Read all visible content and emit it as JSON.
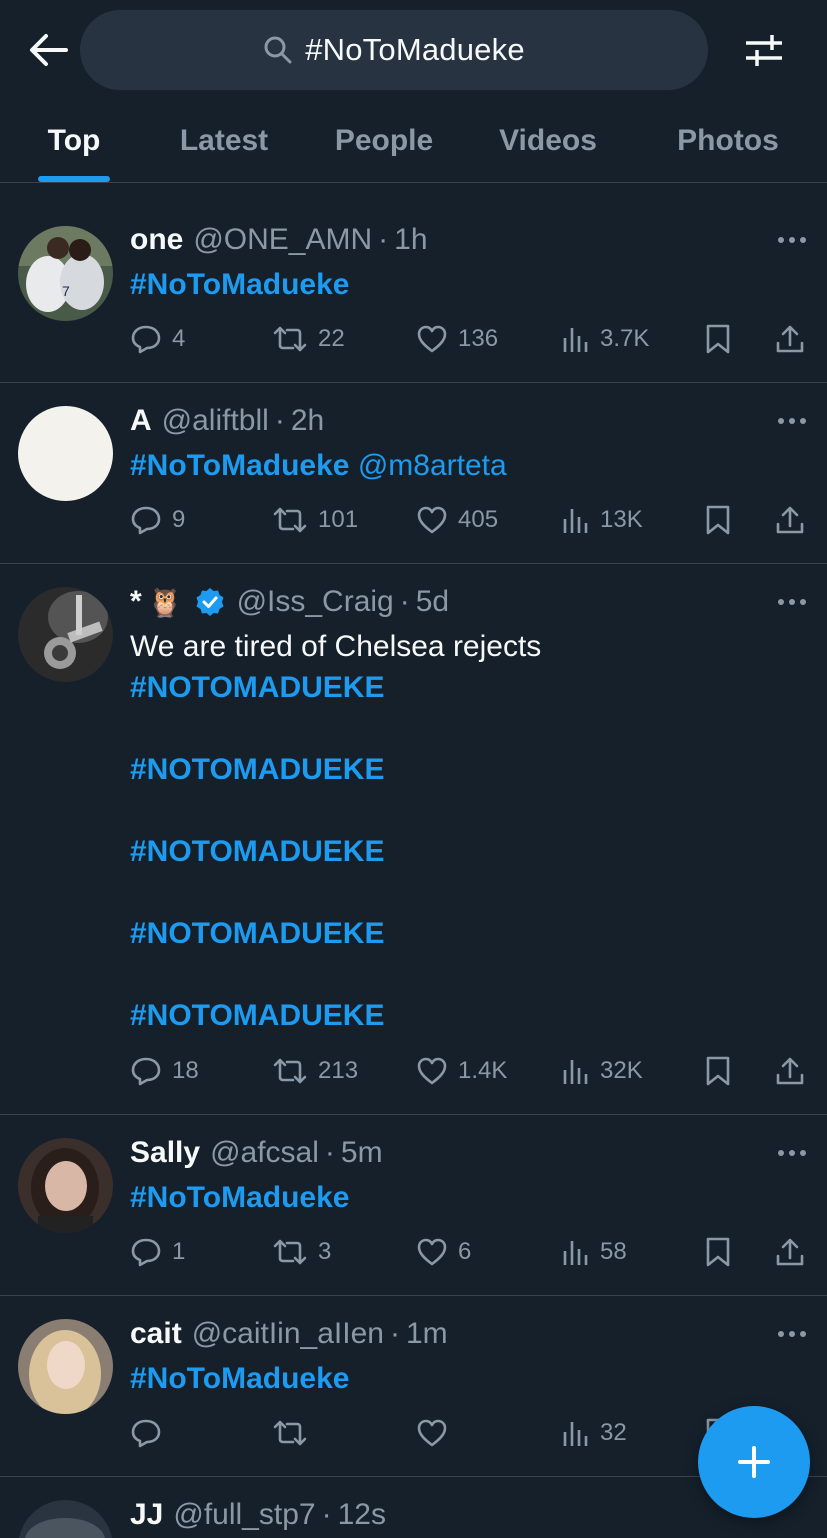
{
  "header": {
    "back_icon": "arrow-left-icon",
    "search_icon": "search-icon",
    "search_query": "#NoToMadueke",
    "filter_icon": "sliders-icon"
  },
  "tabs": [
    {
      "label": "Top",
      "active": true
    },
    {
      "label": "Latest",
      "active": false
    },
    {
      "label": "People",
      "active": false
    },
    {
      "label": "Videos",
      "active": false
    },
    {
      "label": "Photos",
      "active": false
    }
  ],
  "colors": {
    "background": "#15202b",
    "accent": "#1d9bf0",
    "muted": "#8b98a5",
    "divider": "#38444d",
    "verified": "#1d9bf0"
  },
  "tweets": [
    {
      "name": "one",
      "handle": "@ONE_AMN",
      "time": "1h",
      "body": {
        "tag": "#NoToMadueke"
      },
      "replies": "4",
      "retweets": "22",
      "likes": "136",
      "views": "3.7K"
    },
    {
      "name": "A",
      "handle": "@aliftbll",
      "time": "2h",
      "body": {
        "tag": "#NoToMadueke",
        "mention": "@m8arteta"
      },
      "replies": "9",
      "retweets": "101",
      "likes": "405",
      "views": "13K"
    },
    {
      "name": "*",
      "name_emoji": "🦉",
      "verified": true,
      "handle": "@Iss_Craig",
      "time": "5d",
      "body": {
        "text": "We are tired of Chelsea rejects",
        "tags": [
          "#NOTOMADUEKE",
          "#NOTOMADUEKE",
          "#NOTOMADUEKE",
          "#NOTOMADUEKE",
          "#NOTOMADUEKE"
        ]
      },
      "replies": "18",
      "retweets": "213",
      "likes": "1.4K",
      "views": "32K"
    },
    {
      "name": "Sally",
      "handle": "@afcsal",
      "time": "5m",
      "body": {
        "tag": "#NoToMadueke"
      },
      "replies": "1",
      "retweets": "3",
      "likes": "6",
      "views": "58"
    },
    {
      "name": "cait",
      "handle": "@caitIin_aIIen",
      "time": "1m",
      "body": {
        "tag": "#NoToMadueke"
      },
      "replies": "",
      "retweets": "",
      "likes": "",
      "views": "32"
    },
    {
      "name": "JJ",
      "handle": "@full_stp7",
      "time": "12s"
    }
  ],
  "dot_separator": "·",
  "fab": {
    "icon": "plus-icon"
  }
}
